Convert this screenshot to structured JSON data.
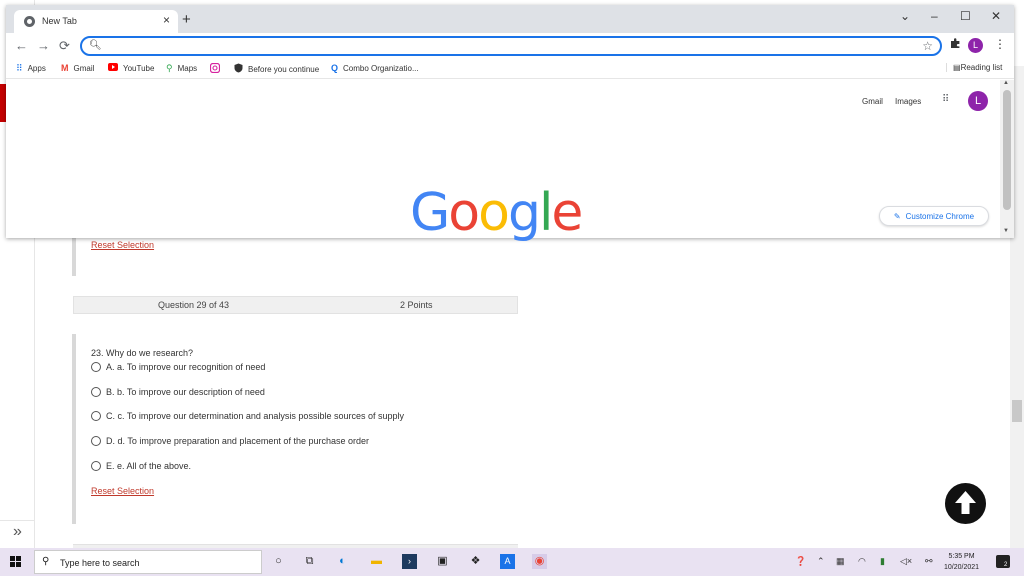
{
  "browser": {
    "tab": {
      "title": "New Tab",
      "close": "×"
    },
    "new_tab": "+",
    "window_controls": {
      "chevron": "⌄",
      "minimize": "–",
      "maximize": "☐",
      "close": "✕"
    },
    "nav": {
      "back": "←",
      "forward": "→",
      "reload": "⟳"
    },
    "omnibox": {
      "value": "",
      "search_glyph": "🔍︎",
      "star": "☆"
    },
    "profile_initial": "L",
    "bookmarks": [
      {
        "label": "Apps"
      },
      {
        "label": "Gmail"
      },
      {
        "label": "YouTube"
      },
      {
        "label": "Maps"
      },
      {
        "label": ""
      },
      {
        "label": "Before you continue"
      },
      {
        "label": "Combo Organizatio..."
      }
    ],
    "reading_list": "Reading list"
  },
  "google_ntp": {
    "links": {
      "gmail": "Gmail",
      "images": "Images"
    },
    "avatar_initial": "L",
    "logo_letters": [
      "G",
      "o",
      "o",
      "g",
      "l",
      "e"
    ],
    "logo_colors": [
      "#4285F4",
      "#EA4335",
      "#FBBC05",
      "#4285F4",
      "#34A853",
      "#EA4335"
    ],
    "customize": "Customize Chrome"
  },
  "quiz": {
    "reset_label": "Reset Selection",
    "question_header": {
      "number": "Question 29 of 43",
      "points": "2 Points"
    },
    "question_text": "23. Why do we research?",
    "options": [
      "A. a. To improve our recognition of need",
      "B. b. To improve our description of need",
      "C. c. To improve our determination and analysis possible sources of supply",
      "D. d. To improve preparation and placement of the purchase order",
      "E. e. All of the above."
    ],
    "collapse": "»"
  },
  "taskbar": {
    "search_placeholder": "Type here to search",
    "time": "5:35 PM",
    "date": "10/20/2021",
    "notification_count": "2"
  },
  "colors": {
    "accent": "#1a73e8",
    "reset_link": "#c0392b",
    "profile": "#8e24aa",
    "taskbar": "#e9e2f2"
  }
}
